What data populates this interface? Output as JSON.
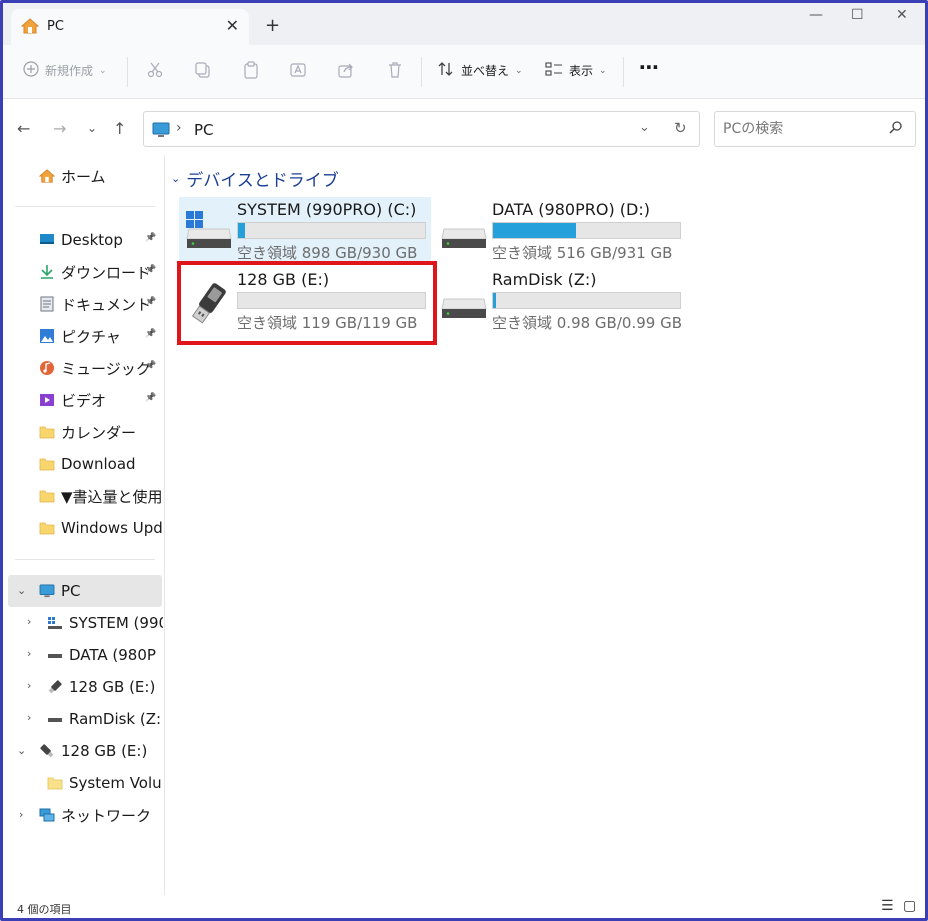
{
  "tab": {
    "title": "PC",
    "close": "✕",
    "new_tab": "+"
  },
  "window_controls": {
    "minimize": "—",
    "maximize": "☐",
    "close": "✕"
  },
  "toolbar": {
    "new_label": "新規作成",
    "sort_label": "並べ替え",
    "view_label": "表示",
    "more_label": "⋯"
  },
  "address": {
    "crumb": "PC",
    "separator": "›"
  },
  "search": {
    "placeholder": "PCの検索"
  },
  "sidebar": {
    "home": "ホーム",
    "pinned": [
      {
        "label": "Desktop",
        "icon": "desktop-icon",
        "color": "#1e88c8"
      },
      {
        "label": "ダウンロード",
        "icon": "download-icon",
        "color": "#2aa56a"
      },
      {
        "label": "ドキュメント",
        "icon": "document-icon",
        "color": "#6b7785"
      },
      {
        "label": "ピクチャ",
        "icon": "pictures-icon",
        "color": "#2f7dd6"
      },
      {
        "label": "ミュージック",
        "icon": "music-icon",
        "color": "#e2663a"
      },
      {
        "label": "ビデオ",
        "icon": "video-icon",
        "color": "#8b3fd1"
      }
    ],
    "folders": [
      {
        "label": "カレンダー"
      },
      {
        "label": "Download"
      },
      {
        "label": "▼書込量と使用"
      },
      {
        "label": "Windows Upd"
      }
    ],
    "pc": "PC",
    "pc_children": [
      {
        "label": "SYSTEM (990",
        "icon": "windows-drive-icon"
      },
      {
        "label": "DATA (980P",
        "icon": "drive-icon"
      },
      {
        "label": "128 GB (E:)",
        "icon": "usb-drive-icon"
      },
      {
        "label": "RamDisk (Z:",
        "icon": "drive-icon"
      }
    ],
    "usb": "128 GB (E:)",
    "usb_children": [
      {
        "label": "System Volu"
      }
    ],
    "network": "ネットワーク"
  },
  "content": {
    "section": "デバイスとドライブ",
    "drives": [
      {
        "name": "SYSTEM (990PRO) (C:)",
        "free": "空き領域 898 GB/930 GB",
        "used_fraction": 0.035,
        "icon": "windows-drive-icon",
        "selected": true
      },
      {
        "name": "DATA (980PRO) (D:)",
        "free": "空き領域 516 GB/931 GB",
        "used_fraction": 0.446,
        "icon": "drive-icon",
        "selected": false
      },
      {
        "name": "128 GB (E:)",
        "free": "空き領域 119 GB/119 GB",
        "used_fraction": 0.0,
        "icon": "usb-drive-icon",
        "selected": false
      },
      {
        "name": "RamDisk (Z:)",
        "free": "空き領域 0.98 GB/0.99 GB",
        "used_fraction": 0.015,
        "icon": "drive-icon",
        "selected": false
      }
    ]
  },
  "status": {
    "count": "4 個の項目"
  },
  "colors": {
    "accent": "#26a0da",
    "highlight": "#e0141b",
    "section": "#1c3f94"
  }
}
